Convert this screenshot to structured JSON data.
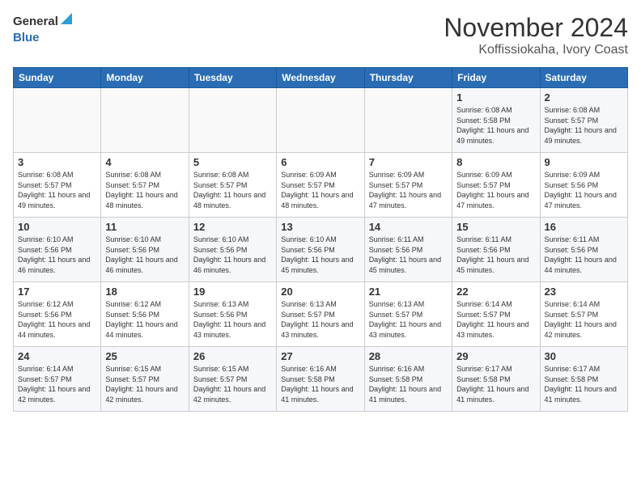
{
  "header": {
    "logo_line1": "General",
    "logo_line2": "Blue",
    "title": "November 2024",
    "subtitle": "Koffissiokaha, Ivory Coast"
  },
  "weekdays": [
    "Sunday",
    "Monday",
    "Tuesday",
    "Wednesday",
    "Thursday",
    "Friday",
    "Saturday"
  ],
  "weeks": [
    [
      {
        "day": "",
        "info": ""
      },
      {
        "day": "",
        "info": ""
      },
      {
        "day": "",
        "info": ""
      },
      {
        "day": "",
        "info": ""
      },
      {
        "day": "",
        "info": ""
      },
      {
        "day": "1",
        "info": "Sunrise: 6:08 AM\nSunset: 5:58 PM\nDaylight: 11 hours and 49 minutes."
      },
      {
        "day": "2",
        "info": "Sunrise: 6:08 AM\nSunset: 5:57 PM\nDaylight: 11 hours and 49 minutes."
      }
    ],
    [
      {
        "day": "3",
        "info": "Sunrise: 6:08 AM\nSunset: 5:57 PM\nDaylight: 11 hours and 49 minutes."
      },
      {
        "day": "4",
        "info": "Sunrise: 6:08 AM\nSunset: 5:57 PM\nDaylight: 11 hours and 48 minutes."
      },
      {
        "day": "5",
        "info": "Sunrise: 6:08 AM\nSunset: 5:57 PM\nDaylight: 11 hours and 48 minutes."
      },
      {
        "day": "6",
        "info": "Sunrise: 6:09 AM\nSunset: 5:57 PM\nDaylight: 11 hours and 48 minutes."
      },
      {
        "day": "7",
        "info": "Sunrise: 6:09 AM\nSunset: 5:57 PM\nDaylight: 11 hours and 47 minutes."
      },
      {
        "day": "8",
        "info": "Sunrise: 6:09 AM\nSunset: 5:57 PM\nDaylight: 11 hours and 47 minutes."
      },
      {
        "day": "9",
        "info": "Sunrise: 6:09 AM\nSunset: 5:56 PM\nDaylight: 11 hours and 47 minutes."
      }
    ],
    [
      {
        "day": "10",
        "info": "Sunrise: 6:10 AM\nSunset: 5:56 PM\nDaylight: 11 hours and 46 minutes."
      },
      {
        "day": "11",
        "info": "Sunrise: 6:10 AM\nSunset: 5:56 PM\nDaylight: 11 hours and 46 minutes."
      },
      {
        "day": "12",
        "info": "Sunrise: 6:10 AM\nSunset: 5:56 PM\nDaylight: 11 hours and 46 minutes."
      },
      {
        "day": "13",
        "info": "Sunrise: 6:10 AM\nSunset: 5:56 PM\nDaylight: 11 hours and 45 minutes."
      },
      {
        "day": "14",
        "info": "Sunrise: 6:11 AM\nSunset: 5:56 PM\nDaylight: 11 hours and 45 minutes."
      },
      {
        "day": "15",
        "info": "Sunrise: 6:11 AM\nSunset: 5:56 PM\nDaylight: 11 hours and 45 minutes."
      },
      {
        "day": "16",
        "info": "Sunrise: 6:11 AM\nSunset: 5:56 PM\nDaylight: 11 hours and 44 minutes."
      }
    ],
    [
      {
        "day": "17",
        "info": "Sunrise: 6:12 AM\nSunset: 5:56 PM\nDaylight: 11 hours and 44 minutes."
      },
      {
        "day": "18",
        "info": "Sunrise: 6:12 AM\nSunset: 5:56 PM\nDaylight: 11 hours and 44 minutes."
      },
      {
        "day": "19",
        "info": "Sunrise: 6:13 AM\nSunset: 5:56 PM\nDaylight: 11 hours and 43 minutes."
      },
      {
        "day": "20",
        "info": "Sunrise: 6:13 AM\nSunset: 5:57 PM\nDaylight: 11 hours and 43 minutes."
      },
      {
        "day": "21",
        "info": "Sunrise: 6:13 AM\nSunset: 5:57 PM\nDaylight: 11 hours and 43 minutes."
      },
      {
        "day": "22",
        "info": "Sunrise: 6:14 AM\nSunset: 5:57 PM\nDaylight: 11 hours and 43 minutes."
      },
      {
        "day": "23",
        "info": "Sunrise: 6:14 AM\nSunset: 5:57 PM\nDaylight: 11 hours and 42 minutes."
      }
    ],
    [
      {
        "day": "24",
        "info": "Sunrise: 6:14 AM\nSunset: 5:57 PM\nDaylight: 11 hours and 42 minutes."
      },
      {
        "day": "25",
        "info": "Sunrise: 6:15 AM\nSunset: 5:57 PM\nDaylight: 11 hours and 42 minutes."
      },
      {
        "day": "26",
        "info": "Sunrise: 6:15 AM\nSunset: 5:57 PM\nDaylight: 11 hours and 42 minutes."
      },
      {
        "day": "27",
        "info": "Sunrise: 6:16 AM\nSunset: 5:58 PM\nDaylight: 11 hours and 41 minutes."
      },
      {
        "day": "28",
        "info": "Sunrise: 6:16 AM\nSunset: 5:58 PM\nDaylight: 11 hours and 41 minutes."
      },
      {
        "day": "29",
        "info": "Sunrise: 6:17 AM\nSunset: 5:58 PM\nDaylight: 11 hours and 41 minutes."
      },
      {
        "day": "30",
        "info": "Sunrise: 6:17 AM\nSunset: 5:58 PM\nDaylight: 11 hours and 41 minutes."
      }
    ]
  ]
}
